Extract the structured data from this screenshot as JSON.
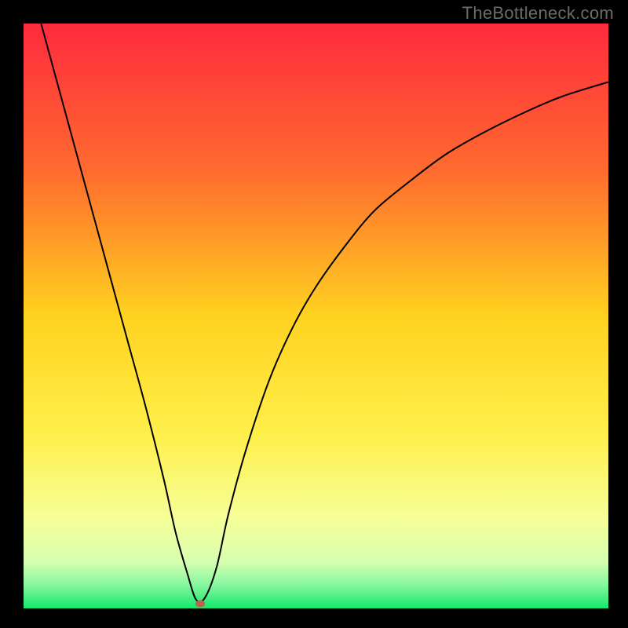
{
  "watermark": "TheBottleneck.com",
  "chart_data": {
    "type": "line",
    "title": "",
    "xlabel": "",
    "ylabel": "",
    "xlim": [
      0,
      100
    ],
    "ylim": [
      0,
      100
    ],
    "background": {
      "style": "vertical-gradient",
      "stops": [
        {
          "y": 0,
          "color": "#ff2a3e"
        },
        {
          "y": 25,
          "color": "#ff6a2f"
        },
        {
          "y": 50,
          "color": "#ffd21f"
        },
        {
          "y": 70,
          "color": "#ffef4a"
        },
        {
          "y": 85,
          "color": "#f5ff9a"
        },
        {
          "y": 92,
          "color": "#d6ffb0"
        },
        {
          "y": 96,
          "color": "#86f7a0"
        },
        {
          "y": 100,
          "color": "#12e86a"
        }
      ]
    },
    "series": [
      {
        "name": "bottleneck-curve",
        "color": "#000000",
        "stroke_width": 2,
        "x": [
          3,
          6,
          9,
          12,
          15,
          18,
          21,
          24,
          26,
          28,
          29.5,
          31,
          33,
          35,
          38,
          42,
          46,
          50,
          55,
          60,
          66,
          72,
          78,
          85,
          92,
          100
        ],
        "y": [
          100,
          89,
          78,
          67,
          56,
          45,
          34,
          22,
          13,
          6,
          1.5,
          1.8,
          7,
          16,
          27,
          39,
          48,
          55,
          62,
          68,
          73,
          77.5,
          81,
          84.5,
          87.5,
          90
        ]
      }
    ],
    "marker": {
      "name": "optimal-point",
      "x": 30.2,
      "y": 0.8,
      "rx": 6,
      "ry": 4.5,
      "color": "#c06050"
    }
  },
  "colors": {
    "frame": "#000000",
    "watermark": "#6b6b6b"
  }
}
